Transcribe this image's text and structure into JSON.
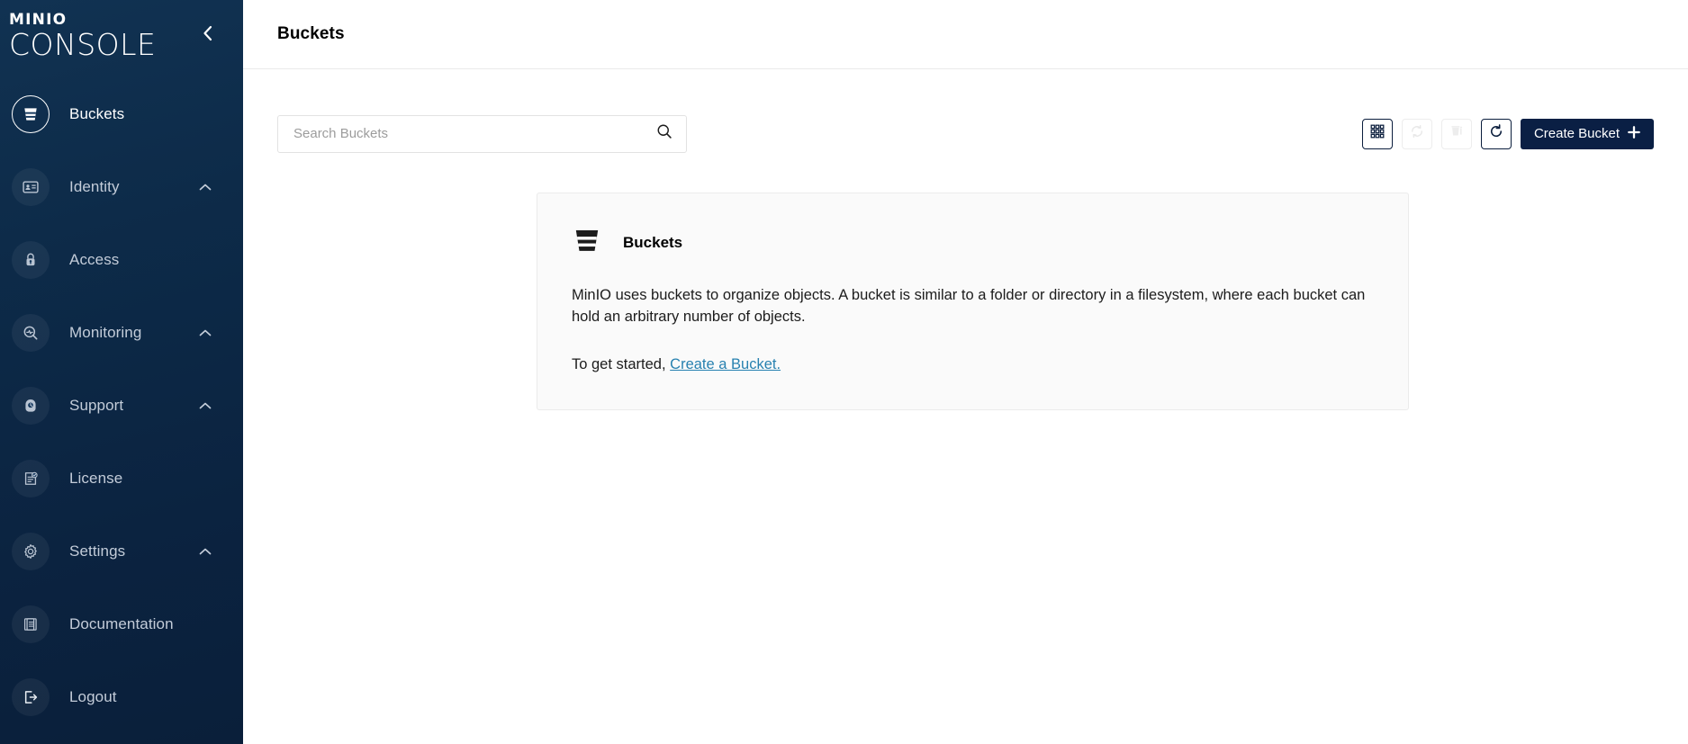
{
  "sidebar": {
    "logo_top": "MINIO",
    "logo_bottom": "CONSOLE",
    "collapse_icon": "chevron-left-icon",
    "items": [
      {
        "label": "Buckets",
        "icon": "bucket-icon",
        "active": true,
        "expandable": false
      },
      {
        "label": "Identity",
        "icon": "identity-card-icon",
        "active": false,
        "expandable": true
      },
      {
        "label": "Access",
        "icon": "lock-icon",
        "active": false,
        "expandable": false
      },
      {
        "label": "Monitoring",
        "icon": "monitoring-icon",
        "active": false,
        "expandable": true
      },
      {
        "label": "Support",
        "icon": "support-icon",
        "active": false,
        "expandable": true
      },
      {
        "label": "License",
        "icon": "license-icon",
        "active": false,
        "expandable": false
      },
      {
        "label": "Settings",
        "icon": "gear-icon",
        "active": false,
        "expandable": true
      },
      {
        "label": "Documentation",
        "icon": "book-icon",
        "active": false,
        "expandable": false
      },
      {
        "label": "Logout",
        "icon": "logout-icon",
        "active": false,
        "expandable": false
      }
    ]
  },
  "header": {
    "title": "Buckets"
  },
  "search": {
    "placeholder": "Search Buckets",
    "value": "",
    "icon": "search-icon"
  },
  "toolbar": {
    "grid_view_icon": "grid-view-icon",
    "sync_icon": "sync-icon",
    "delete_icon": "delete-multiple-icon",
    "refresh_icon": "refresh-icon",
    "create_label": "Create Bucket",
    "create_plus_icon": "plus-icon"
  },
  "info_card": {
    "icon": "bucket-icon",
    "title": "Buckets",
    "description": "MinIO uses buckets to organize objects. A bucket is similar to a folder or directory in a filesystem, where each bucket can hold an arbitrary number of objects.",
    "cta_prefix": "To get started, ",
    "cta_link": "Create a Bucket."
  },
  "colors": {
    "sidebar_bg": "#0d2b49",
    "accent": "#0a1f44",
    "link": "#2781b0",
    "card_bg": "#fafafa"
  }
}
